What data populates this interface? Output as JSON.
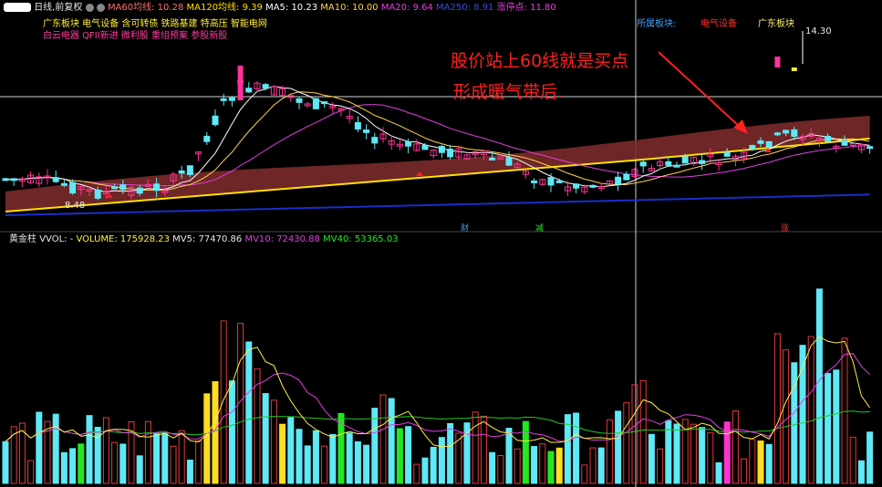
{
  "colors": {
    "bg": "#000000",
    "candle_up": "#ff3399",
    "candle_down": "#5fe8f5",
    "ma5": "#ffffff",
    "ma10": "#ffd24a",
    "ma20": "#e040e0",
    "ma60_band": "#7a2a2a",
    "ma120": "#ffe000",
    "ma250": "#1a2ec8",
    "vol_up": "#e23a3a",
    "vol_down": "#5fe8f5",
    "vol_special_yellow": "#ffdd22",
    "vol_special_green": "#22e822",
    "vol_special_magenta": "#ff33cc",
    "mv5": "#ffee44",
    "mv10": "#e040e0",
    "mv40": "#22c822",
    "annotation": "#ff2020",
    "block_blue": "#3ba0ff",
    "block_red": "#ff3030",
    "block_yellow": "#ffee66"
  },
  "header": {
    "title": "日线,前复权",
    "ma60_label": "MA60均线: 10.28",
    "ma120_label": "MA120均线: 9.39",
    "ma5_label": "MA5: 10.23",
    "ma10_label": "MA10: 10.00",
    "ma20_label": "MA20: 9.64",
    "ma250_label": "MA250: 8.91",
    "limit_label": "涨停点: 11.80"
  },
  "tags": {
    "line1": "广东板块 电气设备 含可转债 铁路基建 特高压 智能电网",
    "line2": "白云电器 QFII新进 微利股 重组预案 参股新股"
  },
  "blocks": {
    "block1": "所属板块:",
    "block2": "电气设备",
    "block3": "广东板块"
  },
  "annotation": {
    "line1": "股价站上60线就是买点",
    "line2": "形成暖气带后."
  },
  "price_labels": {
    "high": "14.30",
    "low": "8.48"
  },
  "event_markers": {
    "m1": "财",
    "m2": "减",
    "m3": "涨"
  },
  "volume_header": {
    "indicator": "黄金柱",
    "vvol": "VVOL: -",
    "volume": "VOLUME: 175928.23",
    "mv5": "MV5: 77470.86",
    "mv10": "MV10: 72430.88",
    "mv40": "MV40: 53365.03"
  }
}
